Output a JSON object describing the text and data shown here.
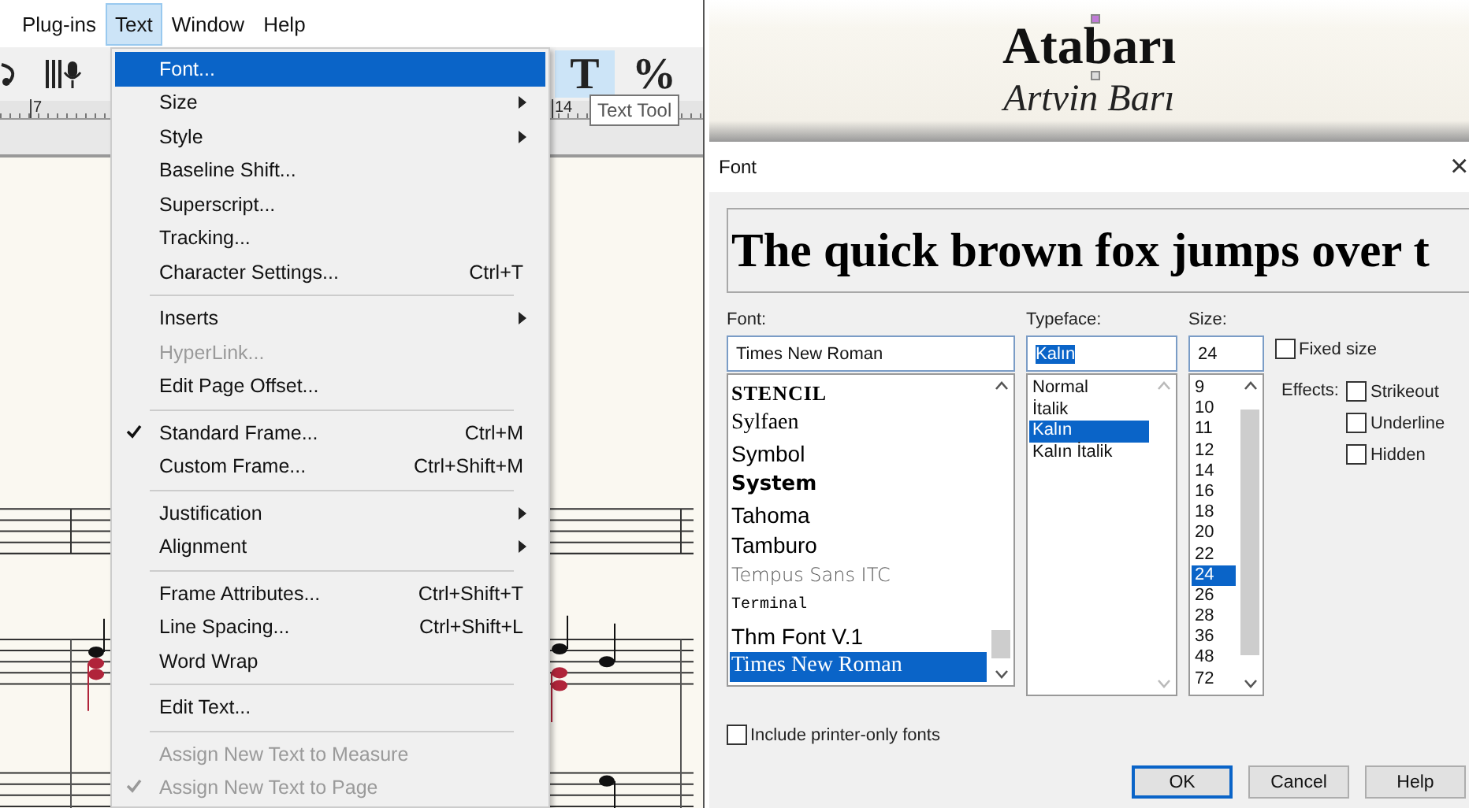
{
  "menu_bar": [
    {
      "label": "Plug-ins",
      "selected": false
    },
    {
      "label": "Text",
      "selected": true
    },
    {
      "label": "Window",
      "selected": false
    },
    {
      "label": "Help",
      "selected": false
    }
  ],
  "ruler": [
    "7",
    "14"
  ],
  "tools": [
    {
      "label": "T",
      "selected": true
    },
    {
      "label": "%",
      "selected": false
    }
  ],
  "tooltip": "Text Tool",
  "menu": [
    {
      "kind": "item",
      "label": "Font...",
      "selected": true,
      "checked": false,
      "disabled": false,
      "submenu": false
    },
    {
      "kind": "item",
      "label": "Size",
      "selected": false,
      "checked": false,
      "disabled": false,
      "submenu": true
    },
    {
      "kind": "item",
      "label": "Style",
      "selected": false,
      "checked": false,
      "disabled": false,
      "submenu": true
    },
    {
      "kind": "item",
      "label": "Baseline Shift...",
      "selected": false,
      "checked": false,
      "disabled": false,
      "submenu": false
    },
    {
      "kind": "item",
      "label": "Superscript...",
      "selected": false,
      "checked": false,
      "disabled": false,
      "submenu": false
    },
    {
      "kind": "item",
      "label": "Tracking...",
      "selected": false,
      "checked": false,
      "disabled": false,
      "submenu": false
    },
    {
      "kind": "item",
      "label": "Character Settings...",
      "shortcut": "Ctrl+T",
      "selected": false,
      "checked": false,
      "disabled": false,
      "submenu": false
    },
    {
      "kind": "separator"
    },
    {
      "kind": "item",
      "label": "Inserts",
      "selected": false,
      "checked": false,
      "disabled": false,
      "submenu": true
    },
    {
      "kind": "item",
      "label": "HyperLink...",
      "selected": false,
      "checked": false,
      "disabled": true,
      "submenu": false
    },
    {
      "kind": "item",
      "label": "Edit Page Offset...",
      "selected": false,
      "checked": false,
      "disabled": false,
      "submenu": false
    },
    {
      "kind": "separator"
    },
    {
      "kind": "item",
      "label": "Standard Frame...",
      "shortcut": "Ctrl+M",
      "selected": false,
      "checked": true,
      "disabled": false,
      "submenu": false
    },
    {
      "kind": "item",
      "label": "Custom Frame...",
      "shortcut": "Ctrl+Shift+M",
      "selected": false,
      "checked": false,
      "disabled": false,
      "submenu": false
    },
    {
      "kind": "separator"
    },
    {
      "kind": "item",
      "label": "Justification",
      "selected": false,
      "checked": false,
      "disabled": false,
      "submenu": true
    },
    {
      "kind": "item",
      "label": "Alignment",
      "selected": false,
      "checked": false,
      "disabled": false,
      "submenu": true
    },
    {
      "kind": "separator"
    },
    {
      "kind": "item",
      "label": "Frame Attributes...",
      "shortcut": "Ctrl+Shift+T",
      "selected": false,
      "checked": false,
      "disabled": false,
      "submenu": false
    },
    {
      "kind": "item",
      "label": "Line Spacing...",
      "shortcut": "Ctrl+Shift+L",
      "selected": false,
      "checked": false,
      "disabled": false,
      "submenu": false
    },
    {
      "kind": "item",
      "label": "Word Wrap",
      "selected": false,
      "checked": false,
      "disabled": false,
      "submenu": false
    },
    {
      "kind": "separator"
    },
    {
      "kind": "item",
      "label": "Edit Text...",
      "selected": false,
      "checked": false,
      "disabled": false,
      "submenu": false
    },
    {
      "kind": "separator"
    },
    {
      "kind": "item",
      "label": "Assign New Text to Measure",
      "selected": false,
      "checked": false,
      "disabled": true,
      "submenu": false
    },
    {
      "kind": "item",
      "label": "Assign New Text to Page",
      "selected": false,
      "checked": true,
      "disabled": true,
      "submenu": false
    }
  ],
  "score_title": {
    "heading": "Atabarı",
    "subtitle": "Artvin Barı"
  },
  "dialog": {
    "title": "Font",
    "close": "×",
    "preview": "The quick brown fox jumps over t",
    "font": {
      "label": "Font:",
      "value": "Times New Roman",
      "items": [
        {
          "label": "STENCIL",
          "kind": "stencil",
          "selected": false
        },
        {
          "label": "Sylfaen",
          "kind": "serif",
          "selected": false
        },
        {
          "label": "Symbol",
          "kind": "sans",
          "selected": false
        },
        {
          "label": "System",
          "kind": "bold",
          "selected": false
        },
        {
          "label": "Tahoma",
          "kind": "sans",
          "selected": false
        },
        {
          "label": "Tamburo",
          "kind": "sans",
          "selected": false
        },
        {
          "label": "Tempus Sans ITC",
          "kind": "light",
          "selected": false
        },
        {
          "label": "Terminal",
          "kind": "mono",
          "selected": false
        },
        {
          "label": "Thm Font V.1",
          "kind": "sans",
          "selected": false
        },
        {
          "label": "Times New Roman",
          "kind": "serif",
          "selected": true
        }
      ]
    },
    "typeface": {
      "label": "Typeface:",
      "value": "Kalın",
      "value_highlighted": true,
      "items": [
        {
          "label": "Normal",
          "selected": false
        },
        {
          "label": "İtalik",
          "selected": false
        },
        {
          "label": "Kalın",
          "selected": true
        },
        {
          "label": "Kalın İtalik",
          "selected": false
        }
      ]
    },
    "size": {
      "label": "Size:",
      "value": "24",
      "items": [
        {
          "label": "9",
          "selected": false
        },
        {
          "label": "10",
          "selected": false
        },
        {
          "label": "11",
          "selected": false
        },
        {
          "label": "12",
          "selected": false
        },
        {
          "label": "14",
          "selected": false
        },
        {
          "label": "16",
          "selected": false
        },
        {
          "label": "18",
          "selected": false
        },
        {
          "label": "20",
          "selected": false
        },
        {
          "label": "22",
          "selected": false
        },
        {
          "label": "24",
          "selected": true
        },
        {
          "label": "26",
          "selected": false
        },
        {
          "label": "28",
          "selected": false
        },
        {
          "label": "36",
          "selected": false
        },
        {
          "label": "48",
          "selected": false
        },
        {
          "label": "72",
          "selected": false
        }
      ]
    },
    "fixed_size": {
      "label": "Fixed size",
      "checked": false
    },
    "effects": {
      "label": "Effects:",
      "options": [
        {
          "label": "Strikeout",
          "checked": false
        },
        {
          "label": "Underline",
          "checked": false
        },
        {
          "label": "Hidden",
          "checked": false
        }
      ]
    },
    "printer_only": {
      "label": "Include printer-only fonts",
      "checked": false
    },
    "buttons": [
      {
        "label": "OK",
        "default": true
      },
      {
        "label": "Cancel",
        "default": false
      },
      {
        "label": "Help",
        "default": false
      }
    ]
  }
}
